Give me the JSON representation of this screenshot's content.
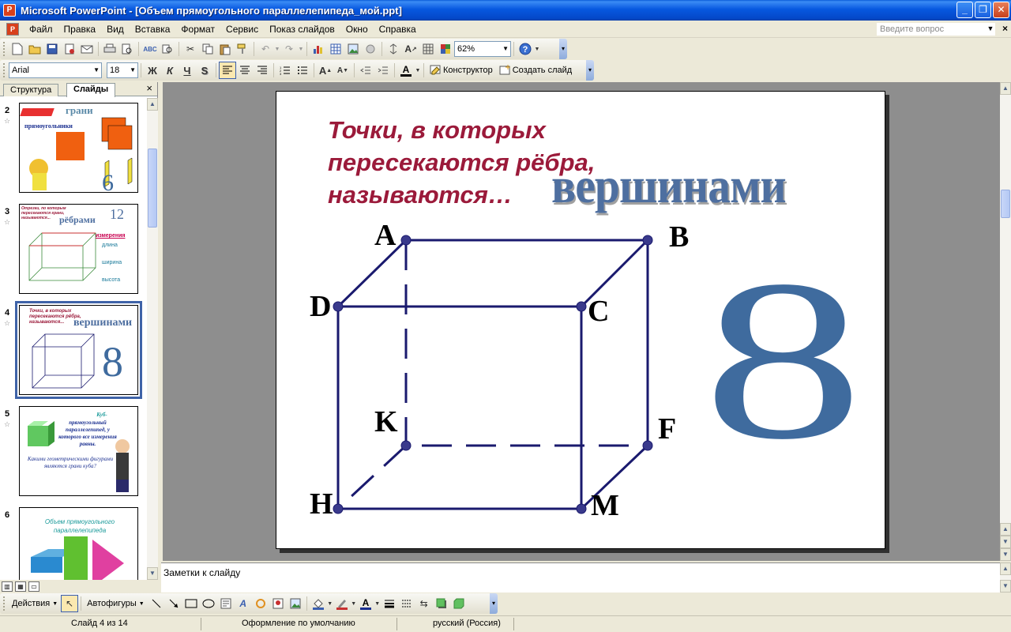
{
  "window": {
    "title": "Microsoft PowerPoint - [Объем прямоугольного параллелепипеда_мой.ppt]",
    "minimize": "_",
    "maximize": "❐",
    "close": "✕"
  },
  "menu": {
    "items": [
      "Файл",
      "Правка",
      "Вид",
      "Вставка",
      "Формат",
      "Сервис",
      "Показ слайдов",
      "Окно",
      "Справка"
    ],
    "ask_placeholder": "Введите вопрос",
    "close": "×"
  },
  "standard_toolbar": {
    "zoom": "62%"
  },
  "formatting_toolbar": {
    "font": "Arial",
    "font_size": "18",
    "bold": "Ж",
    "italic": "К",
    "underline": "Ч",
    "shadow": "S",
    "designer": "Конструктор",
    "new_slide": "Создать слайд"
  },
  "left_pane": {
    "tabs": [
      "Структура",
      "Слайды"
    ],
    "close": "×",
    "thumbnails": [
      {
        "num": "2",
        "title": "грани",
        "subtitle": "прямоугольники",
        "count": "6"
      },
      {
        "num": "3",
        "text": "Отрезки, по которым пересекаются грани, называются...",
        "answer": "рёбрами",
        "count": "12",
        "dimensions_title": "измерения",
        "dims": [
          "длина",
          "ширина",
          "высота"
        ]
      },
      {
        "num": "4",
        "text": "Точки, в которых пересекаются рёбра, называются...",
        "answer": "вершинами",
        "count": "8"
      },
      {
        "num": "5",
        "text1": "Куб-",
        "text2": "прямоугольный параллелепипед, у которого все измерения равны.",
        "question": "Какими геометрическими фигурами являются грани куба?"
      },
      {
        "num": "6",
        "text": "Объем прямоугольного параллелепипеда"
      }
    ]
  },
  "slide": {
    "lines": [
      "Точки, в которых",
      "пересекаются рёбра,",
      "называются…"
    ],
    "answer": "вершинами",
    "count": "8",
    "vertices": {
      "A": "A",
      "B": "B",
      "C": "C",
      "D": "D",
      "K": "K",
      "F": "F",
      "H": "H",
      "M": "M"
    },
    "colors": {
      "title": "#9b1a3a",
      "answer": "#4e6fa0",
      "edges": "#1a1a6e",
      "dot": "#3a3a8c",
      "count": "#3f6b9e"
    }
  },
  "notes": {
    "placeholder": "Заметки к слайду"
  },
  "drawing_toolbar": {
    "actions": "Действия",
    "autoshapes": "Автофигуры"
  },
  "status": {
    "slide": "Слайд 4 из 14",
    "design": "Оформление по умолчанию",
    "language": "русский (Россия)"
  }
}
